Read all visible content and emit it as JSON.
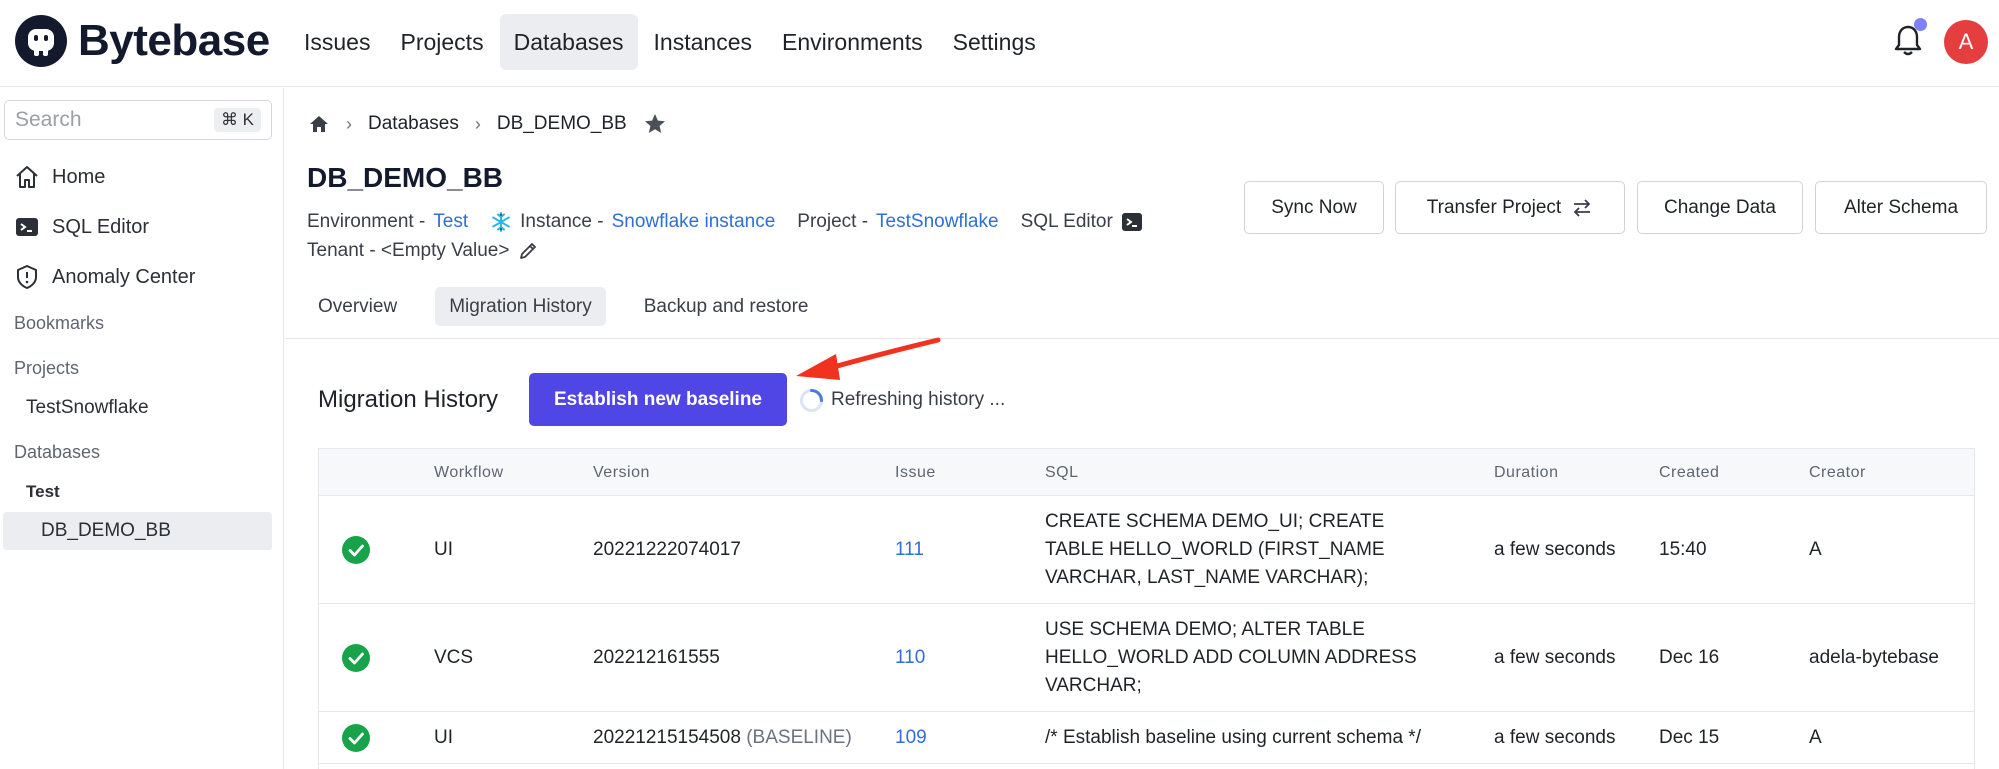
{
  "brand": {
    "name": "Bytebase"
  },
  "nav": {
    "items": [
      "Issues",
      "Projects",
      "Databases",
      "Instances",
      "Environments",
      "Settings"
    ],
    "active": "Databases"
  },
  "user": {
    "avatar_letter": "A"
  },
  "sidebar": {
    "search_placeholder": "Search",
    "shortcut": "⌘ K",
    "links": [
      "Home",
      "SQL Editor",
      "Anomaly Center"
    ],
    "bookmarks_label": "Bookmarks",
    "projects_label": "Projects",
    "project_item": "TestSnowflake",
    "databases_label": "Databases",
    "env_label": "Test",
    "db_item": "DB_DEMO_BB"
  },
  "breadcrumb": {
    "databases": "Databases",
    "current": "DB_DEMO_BB"
  },
  "page": {
    "title": "DB_DEMO_BB",
    "env_label": "Environment -",
    "env_value": "Test",
    "instance_label": "Instance -",
    "instance_value": "Snowflake instance",
    "project_label": "Project -",
    "project_value": "TestSnowflake",
    "sql_editor": "SQL Editor",
    "tenant": "Tenant - <Empty Value>"
  },
  "actions": {
    "sync": "Sync Now",
    "transfer": "Transfer Project",
    "change": "Change Data",
    "alter": "Alter Schema"
  },
  "tabs": [
    "Overview",
    "Migration History",
    "Backup and restore"
  ],
  "history": {
    "title": "Migration History",
    "establish": "Establish new baseline",
    "refreshing": "Refreshing history ..."
  },
  "table": {
    "headers": [
      "Workflow",
      "Version",
      "Issue",
      "SQL",
      "Duration",
      "Created",
      "Creator"
    ],
    "rows": [
      {
        "workflow": "UI",
        "version": "20221222074017",
        "tag": "",
        "issue": "111",
        "sql": "CREATE SCHEMA DEMO_UI; CREATE TABLE HELLO_WORLD (FIRST_NAME VARCHAR, LAST_NAME VARCHAR);",
        "duration": "a few seconds",
        "created": "15:40",
        "creator": "A"
      },
      {
        "workflow": "VCS",
        "version": "202212161555",
        "tag": "",
        "issue": "110",
        "sql": "USE SCHEMA DEMO; ALTER TABLE HELLO_WORLD ADD COLUMN ADDRESS VARCHAR;",
        "duration": "a few seconds",
        "created": "Dec 16",
        "creator": "adela-bytebase"
      },
      {
        "workflow": "UI",
        "version": "20221215154508",
        "tag": "(BASELINE)",
        "issue": "109",
        "sql": "/* Establish baseline using current schema */",
        "duration": "a few seconds",
        "created": "Dec 15",
        "creator": "A"
      }
    ]
  },
  "colors": {
    "primary": "#4f46e5",
    "link": "#2f6fd6",
    "success": "#16a34a",
    "avatar": "#e53e3e",
    "arrow": "#f0321e"
  }
}
